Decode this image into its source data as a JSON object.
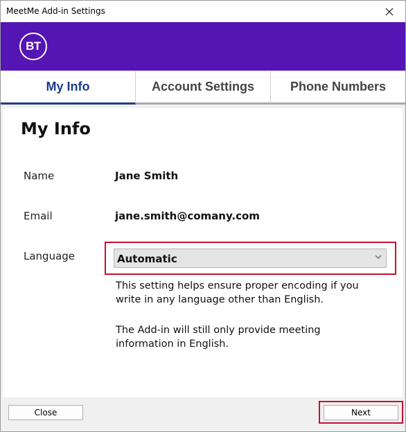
{
  "window": {
    "title": "MeetMe Add-in Settings",
    "close_icon": "close-icon"
  },
  "brand": {
    "logo_text": "BT",
    "color": "#5514b4"
  },
  "tabs": [
    {
      "label": "My Info",
      "active": true
    },
    {
      "label": "Account Settings",
      "active": false
    },
    {
      "label": "Phone Numbers",
      "active": false
    }
  ],
  "page": {
    "title": "My Info",
    "name_label": "Name",
    "name_value": "Jane Smith",
    "email_label": "Email",
    "email_value": "jane.smith@comany.com",
    "language_label": "Language",
    "language_value": "Automatic",
    "help_1": "This setting helps ensure proper encoding if you write in any language other than English.",
    "help_2": "The Add-in will still only provide meeting information in English."
  },
  "footer": {
    "close_label": "Close",
    "next_label": "Next"
  },
  "colors": {
    "accent": "#1c3c8c",
    "highlight": "#c8102e"
  }
}
